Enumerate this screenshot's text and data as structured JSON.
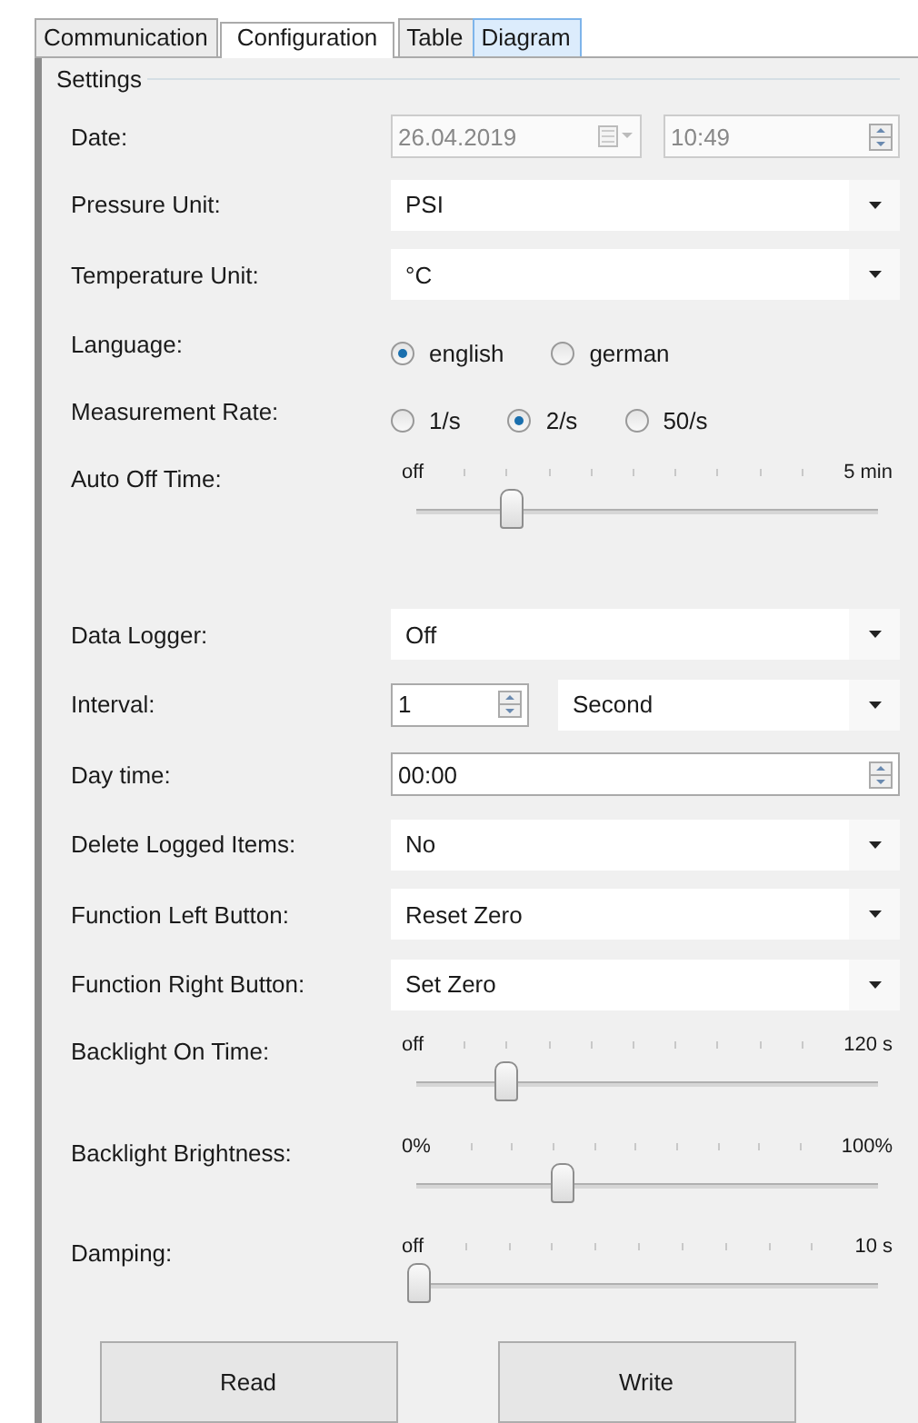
{
  "tabs": [
    {
      "label": "Communication",
      "selected": false,
      "hover": false
    },
    {
      "label": "Configuration",
      "selected": true,
      "hover": false
    },
    {
      "label": "Table",
      "selected": false,
      "hover": false
    },
    {
      "label": "Diagram",
      "selected": false,
      "hover": true
    }
  ],
  "group": {
    "title": "Settings"
  },
  "rows": [
    {
      "kind": "datetime",
      "label": "Date:",
      "date": "26.04.2019",
      "time": "10:49",
      "disabled": true
    },
    {
      "kind": "dropdown",
      "label": "Pressure Unit:",
      "value": "PSI"
    },
    {
      "kind": "dropdown",
      "label": "Temperature Unit:",
      "value": "°C"
    },
    {
      "kind": "radio",
      "label": "Language:",
      "options": [
        {
          "label": "english",
          "selected": true
        },
        {
          "label": "german",
          "selected": false
        }
      ]
    },
    {
      "kind": "radio",
      "label": "Measurement Rate:",
      "options": [
        {
          "label": "1/s",
          "selected": false
        },
        {
          "label": "2/s",
          "selected": true
        },
        {
          "label": "50/s",
          "selected": false
        }
      ]
    },
    {
      "kind": "slider",
      "label": "Auto Off Time:",
      "min_label": "off",
      "max_label": "5 min",
      "level": 0.2
    },
    {
      "kind": "dropdown",
      "label": "Data Logger:",
      "value": "Off"
    },
    {
      "kind": "spin_dropdown",
      "label": "Interval:",
      "number": "1",
      "value": "Second"
    },
    {
      "kind": "time",
      "label": "Day time:",
      "value": "00:00"
    },
    {
      "kind": "dropdown",
      "label": "Delete Logged Items:",
      "value": "No"
    },
    {
      "kind": "dropdown",
      "label": "Function Left Button:",
      "value": "Reset Zero"
    },
    {
      "kind": "dropdown",
      "label": "Function Right Button:",
      "value": "Set Zero"
    },
    {
      "kind": "slider",
      "label": "Backlight On Time:",
      "min_label": "off",
      "max_label": "120 s",
      "level": 0.19
    },
    {
      "kind": "slider",
      "label": "Backlight Brightness:",
      "min_label": "0%",
      "max_label": "100%",
      "level": 0.31
    },
    {
      "kind": "slider",
      "label": "Damping:",
      "min_label": "off",
      "max_label": "10 s",
      "level": 0
    }
  ],
  "buttons": [
    "Read",
    "Write"
  ]
}
